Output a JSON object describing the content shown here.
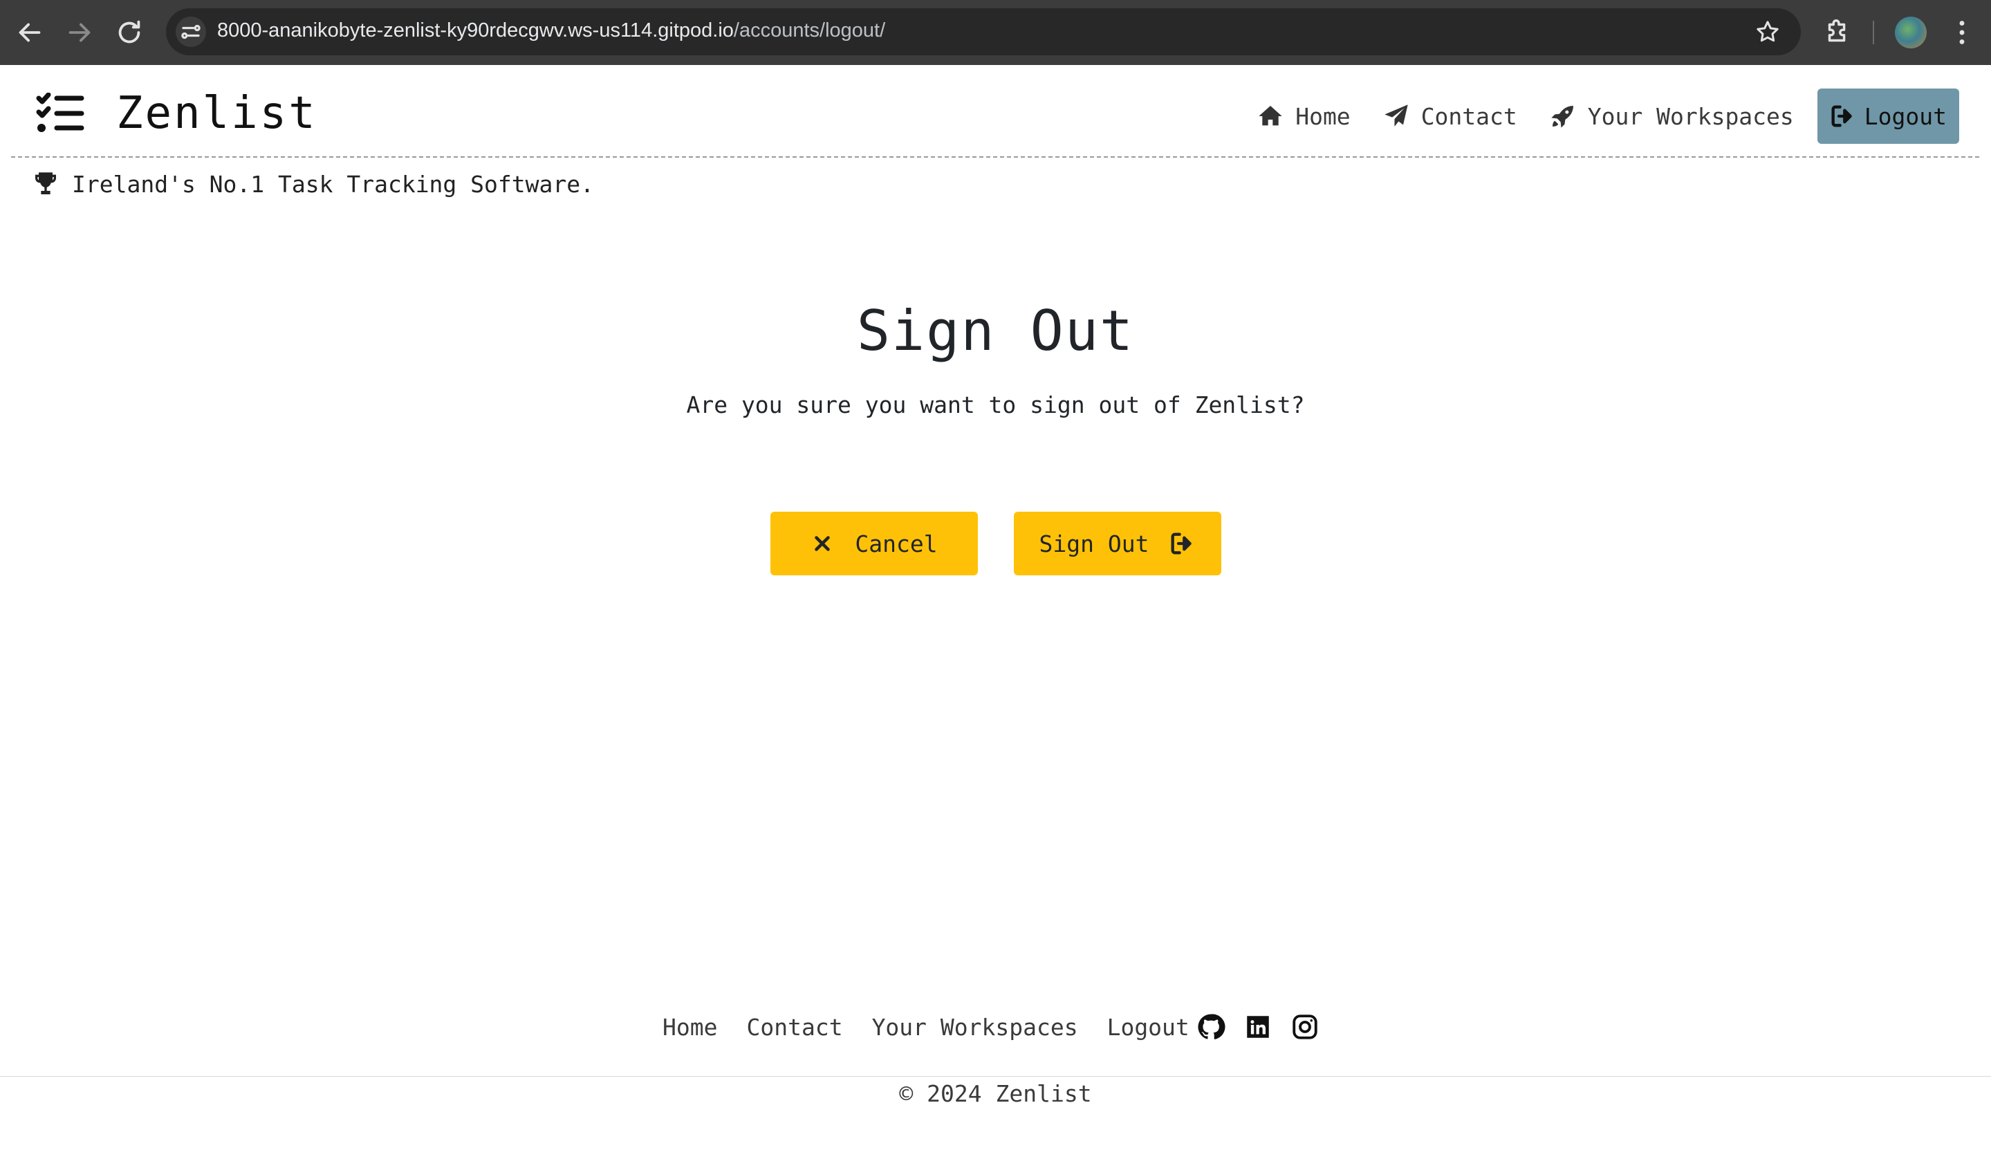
{
  "browser": {
    "url_host": "8000-ananikobyte-zenlist-ky90rdecgwv.ws-us114.gitpod.io",
    "url_path": "/accounts/logout/"
  },
  "header": {
    "brand": "Zenlist",
    "nav": {
      "home": "Home",
      "contact": "Contact",
      "workspaces": "Your Workspaces",
      "logout": "Logout"
    },
    "tagline": "Ireland's No.1 Task Tracking Software."
  },
  "main": {
    "title": "Sign Out",
    "message": "Are you sure you want to sign out of Zenlist?",
    "cancel_label": "Cancel",
    "signout_label": "Sign Out"
  },
  "footer": {
    "links": {
      "home": "Home",
      "contact": "Contact",
      "workspaces": "Your Workspaces",
      "logout": "Logout"
    },
    "social": [
      "github-icon",
      "linkedin-icon",
      "instagram-icon"
    ],
    "copyright": "© 2024 Zenlist"
  },
  "colors": {
    "button_accent": "#ffc107",
    "active_nav": "#6f97a8",
    "browser_chrome": "#3c3c3c"
  }
}
